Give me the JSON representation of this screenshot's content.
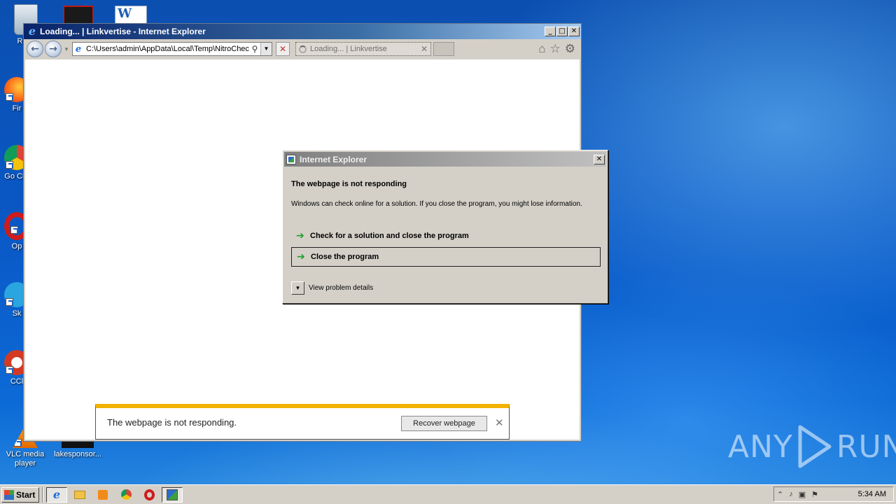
{
  "desktop": {
    "icons": [
      {
        "label": "Recy",
        "icon": "recycle-bin"
      },
      {
        "label": "Fir",
        "icon": "firefox"
      },
      {
        "label": "Go Chr",
        "icon": "chrome"
      },
      {
        "label": "Op",
        "icon": "opera"
      },
      {
        "label": "Sk",
        "icon": "skype"
      },
      {
        "label": "CCl",
        "icon": "ccleaner"
      },
      {
        "label": "VLC media player",
        "icon": "vlc"
      },
      {
        "label": "lakesponsor...",
        "icon": "app"
      }
    ]
  },
  "ie_window": {
    "title": "Loading... | Linkvertise - Internet Explorer",
    "address": "C:\\Users\\admin\\AppData\\Local\\Temp\\NitroChec",
    "tab_label": "Loading... | Linkvertise"
  },
  "notification_bar": {
    "message": "The webpage is not responding.",
    "button": "Recover webpage",
    "accent": "#f2b200"
  },
  "dialog": {
    "title": "Internet Explorer",
    "heading": "The webpage is not responding",
    "body": "Windows can check online for a solution. If you close the program, you might lose information.",
    "options": [
      {
        "label": "Check for a solution and close the program",
        "selected": false
      },
      {
        "label": "Close the program",
        "selected": true
      }
    ],
    "details_label": "View problem details"
  },
  "watermark": {
    "left": "ANY",
    "right": "RUN"
  },
  "taskbar": {
    "start_label": "Start",
    "clock": "5:34 AM",
    "pinned": [
      "internet-explorer",
      "explorer",
      "media-player",
      "chrome",
      "opera",
      "error-reporting"
    ]
  }
}
